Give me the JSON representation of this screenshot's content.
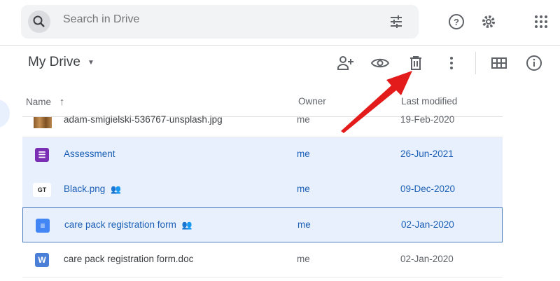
{
  "search": {
    "placeholder": "Search in Drive"
  },
  "header": {
    "title": "My Drive"
  },
  "columns": {
    "name": "Name",
    "owner": "Owner",
    "modified": "Last modified"
  },
  "rows": [
    {
      "name": "adam-smigielski-536767-unsplash.jpg",
      "owner": "me",
      "modified": "19-Feb-2020",
      "type": "image",
      "shared": false
    },
    {
      "name": "Assessment",
      "owner": "me",
      "modified": "26-Jun-2021",
      "type": "form",
      "shared": false
    },
    {
      "name": "Black.png",
      "owner": "me",
      "modified": "09-Dec-2020",
      "type": "image",
      "shared": true,
      "thumb": "GT"
    },
    {
      "name": "care pack registration form",
      "owner": "me",
      "modified": "02-Jan-2020",
      "type": "doc",
      "shared": true
    },
    {
      "name": "care pack registration form.doc",
      "owner": "me",
      "modified": "02-Jan-2020",
      "type": "word",
      "shared": false,
      "thumb": "W"
    }
  ],
  "colors": {
    "accent": "#1a73e8",
    "annotation": "#e31b1b"
  }
}
